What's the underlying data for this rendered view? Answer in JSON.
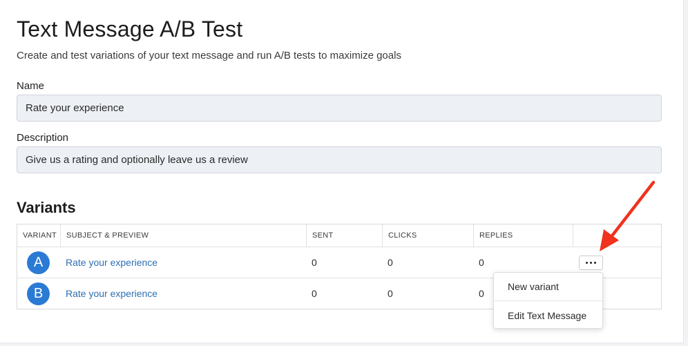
{
  "page": {
    "title": "Text Message A/B Test",
    "subtitle": "Create and test variations of your text message and run A/B tests to maximize goals"
  },
  "form": {
    "name_label": "Name",
    "name_value": "Rate your experience",
    "description_label": "Description",
    "description_value": "Give us a rating and optionally leave us a review"
  },
  "variants": {
    "section_title": "Variants",
    "columns": [
      "VARIANT",
      "SUBJECT & PREVIEW",
      "SENT",
      "CLICKS",
      "REPLIES"
    ],
    "rows": [
      {
        "variant": "A",
        "subject": "Rate your experience",
        "sent": "0",
        "clicks": "0",
        "replies": "0"
      },
      {
        "variant": "B",
        "subject": "Rate your experience",
        "sent": "0",
        "clicks": "0",
        "replies": "0"
      }
    ]
  },
  "menu": {
    "items": [
      "New variant",
      "Edit Text Message"
    ]
  },
  "colors": {
    "accent": "#2b7ad4",
    "link": "#2e6fb2",
    "annotation_arrow": "#f0321e",
    "input_bg": "#edf0f5"
  },
  "icons": {
    "more": "more-horizontal-icon",
    "annotation": "red-arrow-annotation"
  }
}
